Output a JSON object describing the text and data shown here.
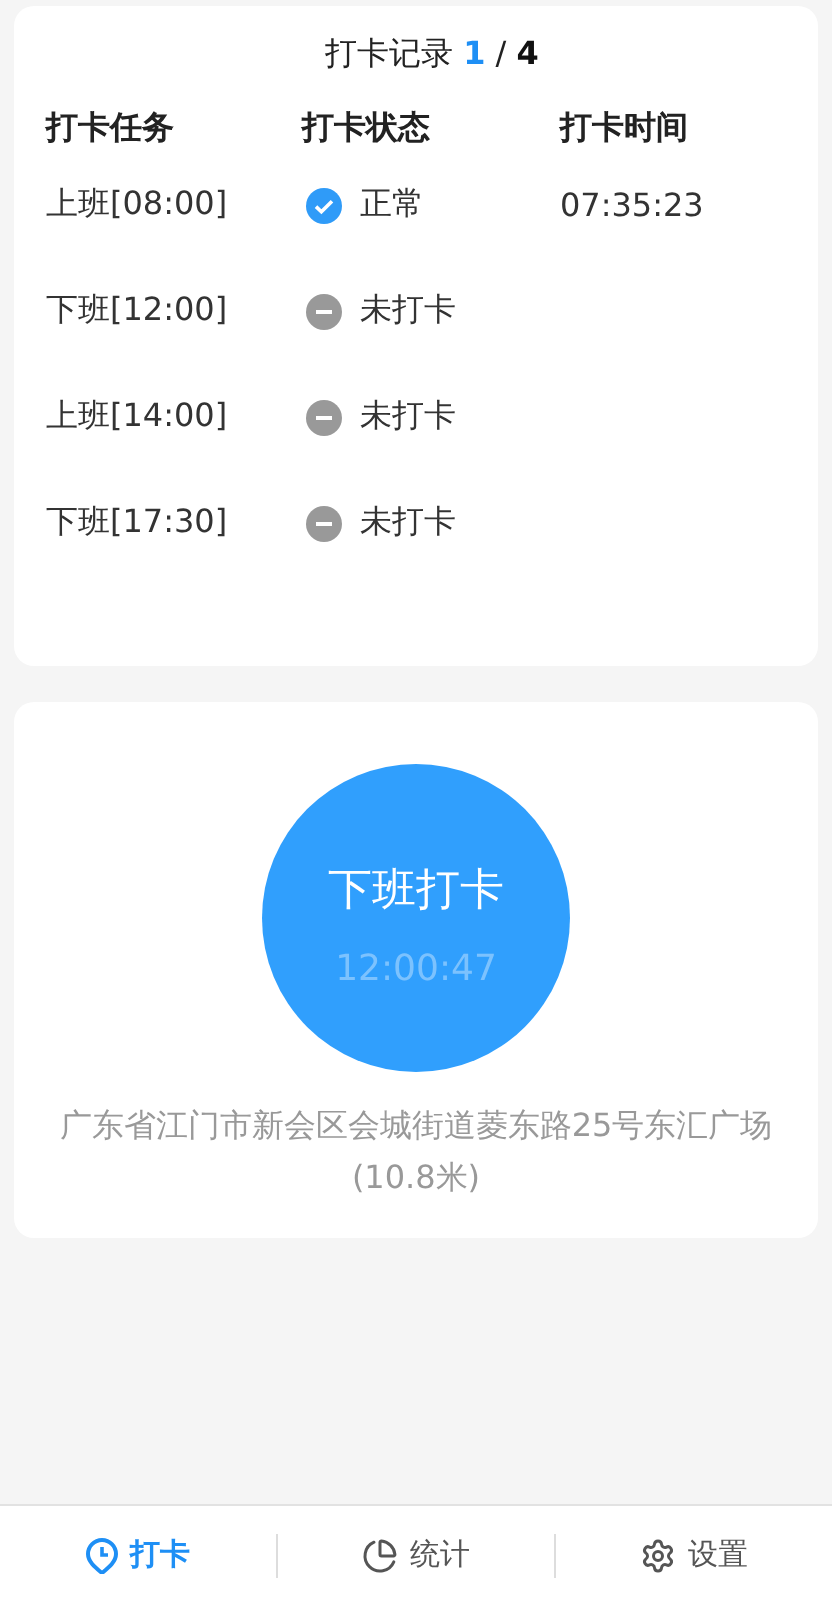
{
  "record": {
    "title": "打卡记录",
    "page_current": "1",
    "page_separator": "/",
    "page_total": "4",
    "columns": [
      "打卡任务",
      "打卡状态",
      "打卡时间"
    ],
    "rows": [
      {
        "task": "上班[08:00]",
        "status": {
          "kind": "normal",
          "label": "正常"
        },
        "time": "07:35:23"
      },
      {
        "task": "下班[12:00]",
        "status": {
          "kind": "missed",
          "label": "未打卡"
        }
      },
      {
        "task": "上班[14:00]",
        "status": {
          "kind": "missed",
          "label": "未打卡"
        }
      },
      {
        "task": "下班[17:30]",
        "status": {
          "kind": "missed",
          "label": "未打卡"
        }
      }
    ]
  },
  "punch": {
    "button_label": "下班打卡",
    "clock": "12:00:47",
    "location": "广东省江门市新会区会城街道菱东路25号东汇广场(10.8米)"
  },
  "tab_bar": [
    {
      "kind": "punch",
      "label": "打卡",
      "selected": true
    },
    {
      "kind": "stats",
      "label": "统计",
      "selected": false
    },
    {
      "kind": "settings",
      "label": "设置",
      "selected": false
    }
  ]
}
